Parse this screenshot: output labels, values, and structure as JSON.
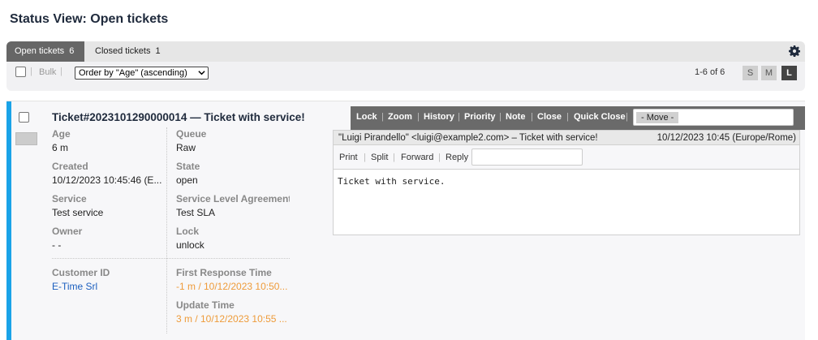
{
  "page": {
    "title": "Status View: Open tickets"
  },
  "tabs": [
    {
      "label": "Open tickets",
      "count": "6",
      "active": true
    },
    {
      "label": "Closed tickets",
      "count": "1",
      "active": false
    }
  ],
  "toolbar": {
    "bulk_label": "Bulk",
    "separator": "|",
    "order_value": "Order by \"Age\" (ascending)",
    "pager_text": "1-6 of 6",
    "sizes": [
      "S",
      "M",
      "L"
    ],
    "selected_size": "L"
  },
  "ticket": {
    "title": "Ticket#2023101290000014 — Ticket with service!",
    "accent_color": "#1aa3e8",
    "left_fields": [
      {
        "label": "Age",
        "value": "6 m"
      },
      {
        "label": "Created",
        "value": "10/12/2023 10:45:46 (E..."
      },
      {
        "label": "Service",
        "value": "Test service"
      },
      {
        "label": "Owner",
        "value": "- -"
      },
      {
        "label": "Customer ID",
        "value": "E-Time Srl"
      }
    ],
    "right_fields": [
      {
        "label": "Queue",
        "value": "Raw"
      },
      {
        "label": "State",
        "value": "open"
      },
      {
        "label": "Service Level Agreement",
        "value": "Test SLA"
      },
      {
        "label": "Lock",
        "value": "unlock"
      },
      {
        "label": "First Response Time",
        "value": "-1 m / 10/12/2023 10:50..."
      },
      {
        "label": "Update Time",
        "value": "3 m / 10/12/2023 10:55 ..."
      }
    ],
    "actions": [
      "Lock",
      "Zoom",
      "History",
      "Priority",
      "Note",
      "Close",
      "Quick Close"
    ],
    "move_label": "- Move -",
    "article": {
      "from": "\"Luigi Pirandello\" <luigi@example2.com> – Ticket with service!",
      "date": "10/12/2023 10:45 (Europe/Rome)",
      "menu": [
        "Print",
        "Split",
        "Forward",
        "Reply"
      ],
      "body": "Ticket with service."
    }
  },
  "icons": {
    "settings": "gear-icon",
    "dropdown": "chevron-down-icon"
  }
}
